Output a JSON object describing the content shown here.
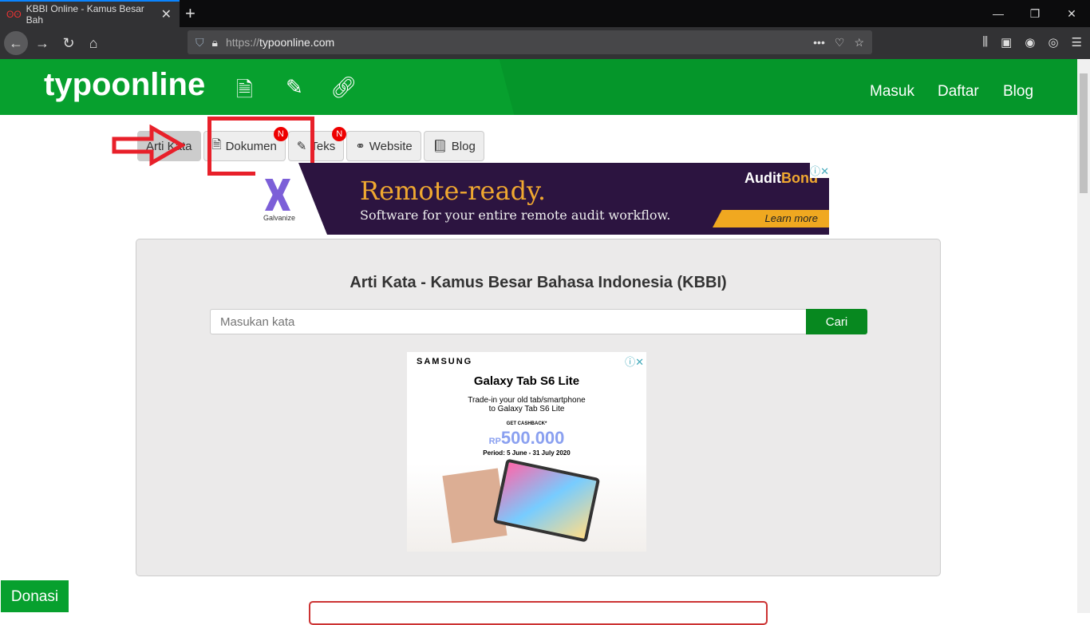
{
  "browser": {
    "tab_title": "KBBI Online - Kamus Besar Bah",
    "url_proto": "https://",
    "url_host": "typoonline.com"
  },
  "header": {
    "logo": "typoonline",
    "nav": [
      "Masuk",
      "Daftar",
      "Blog"
    ]
  },
  "tabs": [
    {
      "label": "Arti Kata"
    },
    {
      "label": "Dokumen",
      "badge": "N"
    },
    {
      "label": "Teks",
      "badge": "N"
    },
    {
      "label": "Website"
    },
    {
      "label": "Blog"
    }
  ],
  "ad_top": {
    "brand": "Galvanize",
    "headline": "Remote-ready.",
    "sub": "Software for your entire remote audit workflow.",
    "logo_a": "Audit",
    "logo_b": "Bond",
    "cta": "Learn more"
  },
  "panel": {
    "title": "Arti Kata - Kamus Besar Bahasa Indonesia (KBBI)",
    "placeholder": "Masukan kata",
    "button": "Cari"
  },
  "ad_mid": {
    "brand": "SAMSUNG",
    "title": "Galaxy Tab S6 Lite",
    "line1": "Trade-in your old tab/smartphone",
    "line2": "to Galaxy Tab S6 Lite",
    "cashback": "GET CASHBACK*",
    "currency": "RP",
    "amount": "500.000",
    "period": "Period: 5 June - 31 July 2020"
  },
  "donasi": "Donasi",
  "colors": {
    "brand_green": "#07a02e",
    "highlight_red": "#e8202a"
  }
}
